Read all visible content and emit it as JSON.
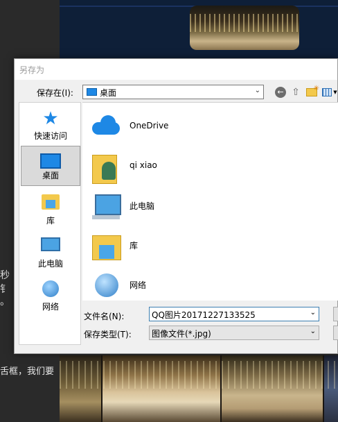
{
  "background": {
    "side_text_1": "秒钅",
    "side_text_2": "。",
    "bottom_text": "舌框，我们要"
  },
  "dialog": {
    "title": "另存为",
    "save_in_label": "保存在(I):",
    "save_in_value": "桌面",
    "places": [
      {
        "label": "快速访问",
        "icon": "star-icon"
      },
      {
        "label": "桌面",
        "icon": "desktop-icon",
        "selected": true
      },
      {
        "label": "库",
        "icon": "library-icon"
      },
      {
        "label": "此电脑",
        "icon": "computer-icon"
      },
      {
        "label": "网络",
        "icon": "network-icon"
      }
    ],
    "files": [
      {
        "name": "OneDrive",
        "icon": "onedrive-icon"
      },
      {
        "name": "qi xiao",
        "icon": "user-folder-icon"
      },
      {
        "name": "此电脑",
        "icon": "computer-icon"
      },
      {
        "name": "库",
        "icon": "library-icon"
      },
      {
        "name": "网络",
        "icon": "network-icon"
      }
    ],
    "filename_label": "文件名(N):",
    "filename_value": "QQ图片20171227133525",
    "filetype_label": "保存类型(T):",
    "filetype_value": "图像文件(*.jpg)"
  }
}
